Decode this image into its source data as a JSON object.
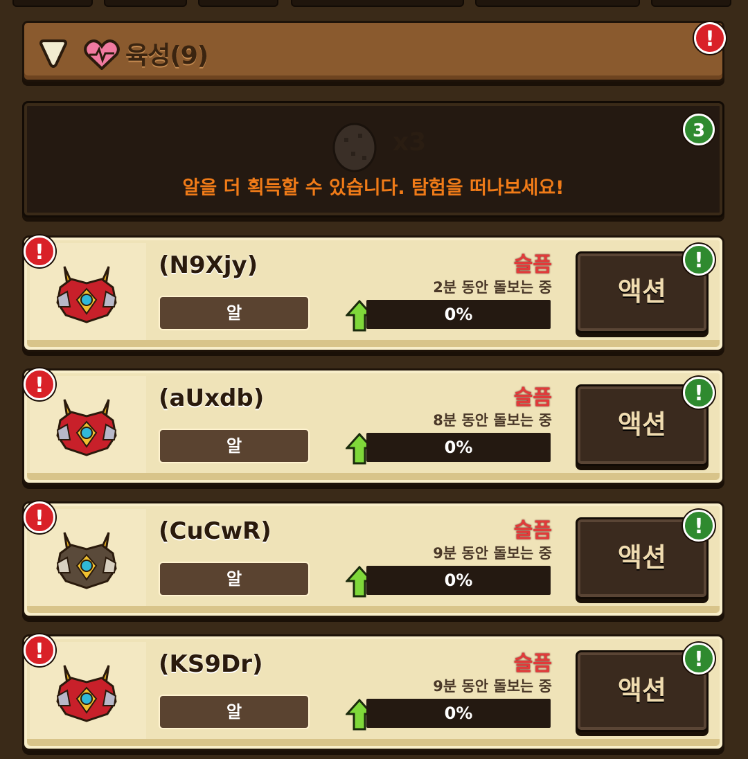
{
  "section": {
    "title": "육성(9)",
    "alert": "!"
  },
  "egg_panel": {
    "count": "x3",
    "message": "알을 더 획득할 수 있습니다. 탐험을 떠나보세요!",
    "badge": "3"
  },
  "pets": [
    {
      "name": "(N9Xjy)",
      "stage": "알",
      "mood": "슬픔",
      "care": "2분 동안 돌보는 중",
      "progress": "0%",
      "progress_value": 0,
      "action": "액션",
      "variant": "red"
    },
    {
      "name": "(aUxdb)",
      "stage": "알",
      "mood": "슬픔",
      "care": "8분 동안 돌보는 중",
      "progress": "0%",
      "progress_value": 0,
      "action": "액션",
      "variant": "red"
    },
    {
      "name": "(CuCwR)",
      "stage": "알",
      "mood": "슬픔",
      "care": "9분 동안 돌보는 중",
      "progress": "0%",
      "progress_value": 0,
      "action": "액션",
      "variant": "dark"
    },
    {
      "name": "(KS9Dr)",
      "stage": "알",
      "mood": "슬픔",
      "care": "9분 동안 돌보는 중",
      "progress": "0%",
      "progress_value": 0,
      "action": "액션",
      "variant": "red"
    }
  ],
  "colors": {
    "alert": "#d92128",
    "notify": "#2f8a2f",
    "mood_sad": "#e23a3a",
    "message": "#f07b18",
    "progress_arrow": "#7fd83a"
  },
  "icons": {
    "collapse": "triangle-down-icon",
    "heart": "heartbeat-icon",
    "egg": "egg-icon",
    "up_arrow": "up-arrow-icon",
    "alert": "exclamation-icon"
  }
}
